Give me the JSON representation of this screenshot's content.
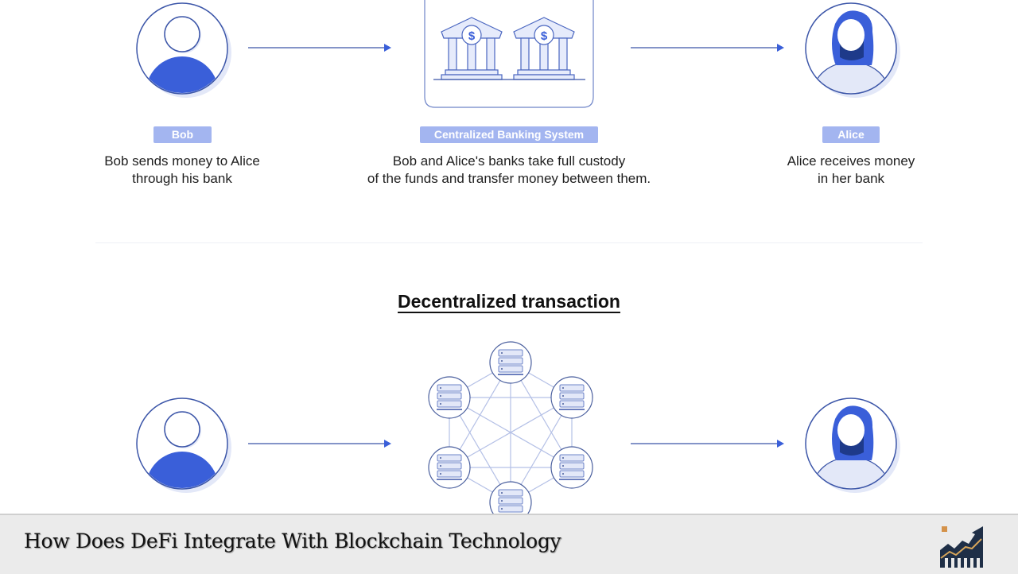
{
  "top": {
    "bob": {
      "label": "Bob",
      "description_line1": "Bob sends money to Alice",
      "description_line2": "through his bank"
    },
    "center": {
      "label": "Centralized Banking System",
      "description_line1": "Bob and Alice's banks take full custody",
      "description_line2": "of the funds and transfer money between them."
    },
    "alice": {
      "label": "Alice",
      "description_line1": "Alice receives money",
      "description_line2": "in her bank"
    }
  },
  "bottom": {
    "title": "Decentralized transaction"
  },
  "footer": {
    "title": "How Does DeFi Integrate With Blockchain Technology",
    "logo_icon": "growth-chart-icon"
  },
  "colors": {
    "primary_blue": "#3a5fd9",
    "outline_blue": "#3b55a8",
    "light_blue": "#dfe6fa",
    "badge_blue": "#a3b5f0",
    "footer_bg": "#ebebeb"
  }
}
